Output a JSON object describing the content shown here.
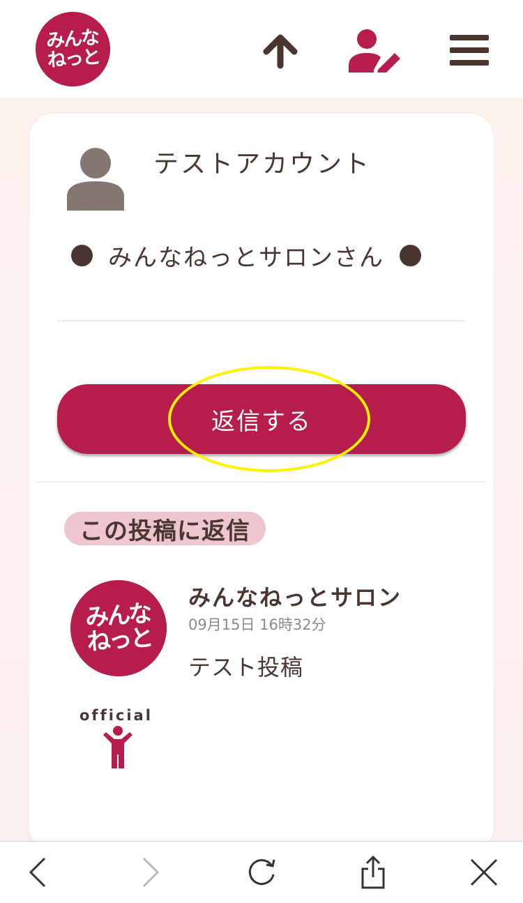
{
  "header": {
    "logo_line1": "みんな",
    "logo_line2": "ねっと",
    "icons": [
      "arrow-up-icon",
      "user-edit-icon",
      "hamburger-menu-icon"
    ]
  },
  "compose": {
    "account_name": "テストアカウント",
    "destination": "みんなねっとサロンさん",
    "reply_button": "返信する"
  },
  "reply_section": {
    "label": "この投稿に返信",
    "post": {
      "logo_line1": "みんな",
      "logo_line2": "ねっと",
      "author": "みんなねっとサロン",
      "timestamp": "09月15日 16時32分",
      "body": "テスト投稿",
      "badge": "official"
    }
  },
  "toolbar": {
    "icons": [
      "back-icon",
      "forward-icon",
      "reload-icon",
      "share-icon",
      "close-icon"
    ]
  },
  "colors": {
    "brand": "#b71d4b",
    "text": "#4a3530",
    "label_bg": "#edc6d0",
    "highlight": "#fff200"
  }
}
